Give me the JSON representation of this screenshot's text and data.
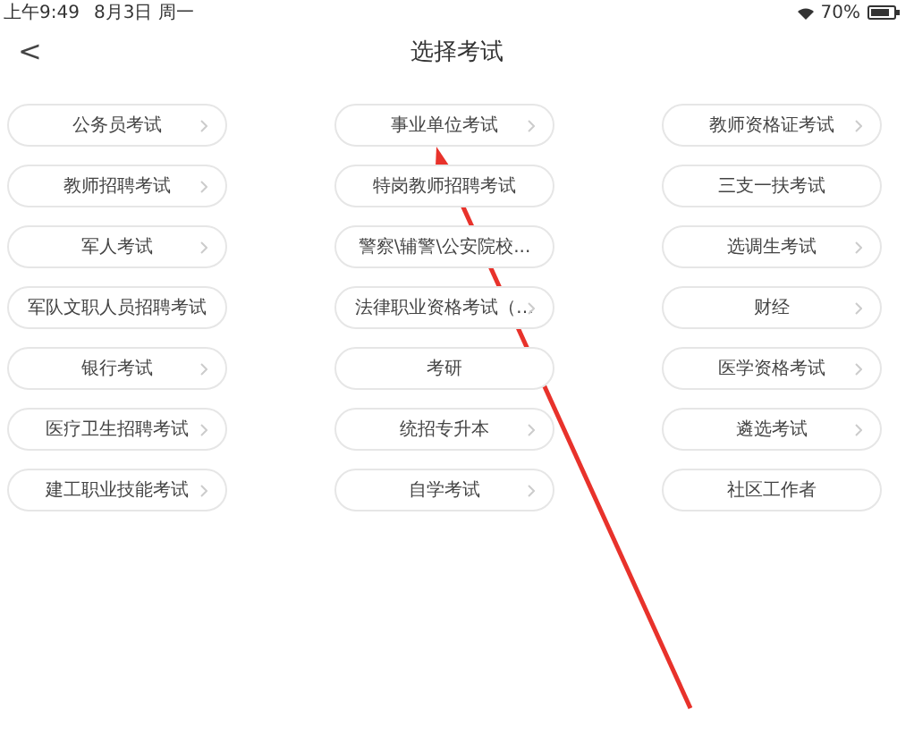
{
  "status_bar": {
    "time": "上午9:49",
    "date": "8月3日 周一",
    "battery": "70%"
  },
  "header": {
    "back": "<",
    "title": "选择考试"
  },
  "exams": [
    {
      "label": "公务员考试",
      "chevron": true
    },
    {
      "label": "事业单位考试",
      "chevron": true
    },
    {
      "label": "教师资格证考试",
      "chevron": true
    },
    {
      "label": "教师招聘考试",
      "chevron": true
    },
    {
      "label": "特岗教师招聘考试",
      "chevron": false
    },
    {
      "label": "三支一扶考试",
      "chevron": false
    },
    {
      "label": "军人考试",
      "chevron": true
    },
    {
      "label": "警察\\辅警\\公安院校...",
      "chevron": false
    },
    {
      "label": "选调生考试",
      "chevron": true
    },
    {
      "label": "军队文职人员招聘考试",
      "chevron": false
    },
    {
      "label": "法律职业资格考试（…",
      "chevron": true
    },
    {
      "label": "财经",
      "chevron": true
    },
    {
      "label": "银行考试",
      "chevron": true
    },
    {
      "label": "考研",
      "chevron": false
    },
    {
      "label": "医学资格考试",
      "chevron": true
    },
    {
      "label": "医疗卫生招聘考试",
      "chevron": true
    },
    {
      "label": "统招专升本",
      "chevron": true
    },
    {
      "label": "遴选考试",
      "chevron": true
    },
    {
      "label": "建工职业技能考试",
      "chevron": true
    },
    {
      "label": "自学考试",
      "chevron": true
    },
    {
      "label": "社区工作者",
      "chevron": false
    }
  ]
}
